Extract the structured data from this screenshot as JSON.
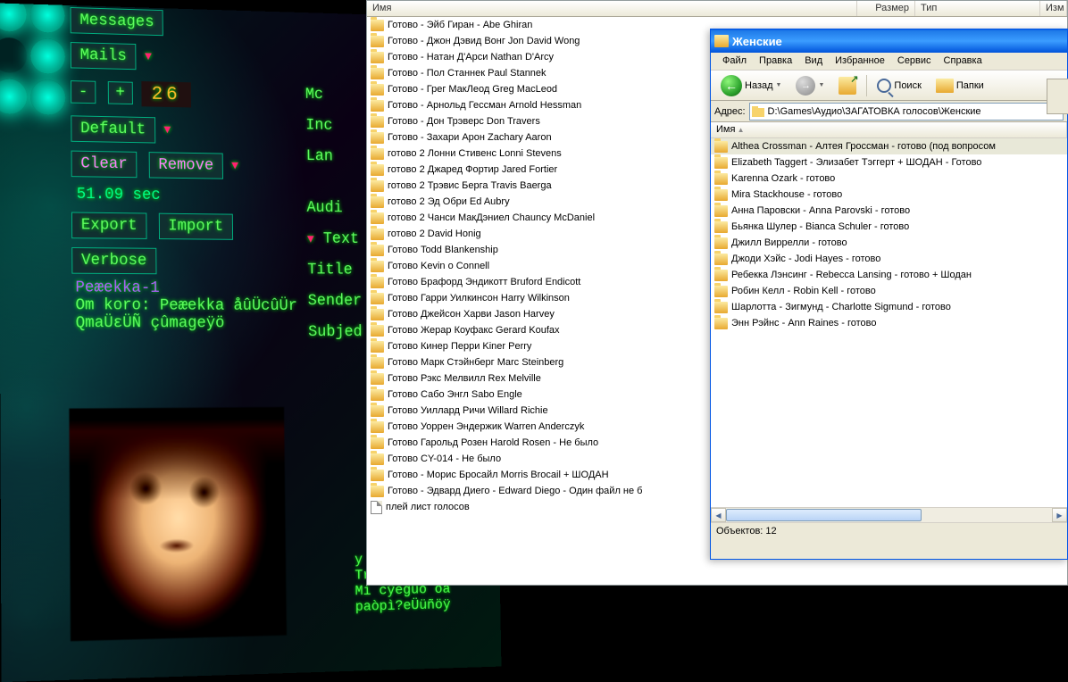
{
  "game": {
    "messages": "Messages",
    "mails": "Mails",
    "number": "26",
    "default": "Default",
    "clear": "Clear",
    "remove": "Remove",
    "timer": "51.09 sec",
    "export": "Export",
    "import": "Import",
    "verbose": "Verbose",
    "rebekka": "Peæekka-1",
    "from": "Om koro: Peæekka åûÜcûÜr",
    "line2": "QmaÜεÜÑ çûmageÿö",
    "rcol": {
      "mc": "Mc",
      "inc": "Inc",
      "lan": "Lan",
      "audi": "Audi",
      "text": "Text",
      "title": "Title",
      "sender": "Sender",
      "subj": "Subjed"
    },
    "chat": "y Æ\nTriOptimum.\nMí cÿegüö òa\npaòpì?eÜüñöÿ"
  },
  "explorer_bg": {
    "columns": {
      "name": "Имя",
      "size": "Размер",
      "type": "Тип",
      "chg": "Изм"
    },
    "items": [
      {
        "t": "folder",
        "n": "Готово - Эйб Гиран - Abe Ghiran"
      },
      {
        "t": "folder",
        "n": "Готово - Джон Дэвид Вонг  Jon David Wong"
      },
      {
        "t": "folder",
        "n": "Готово - Натан Д'Арси Nathan D'Arcy"
      },
      {
        "t": "folder",
        "n": "Готово - Пол Станнек Paul Stannek"
      },
      {
        "t": "folder",
        "n": "Готово - Грег МакЛеод Greg MacLeod"
      },
      {
        "t": "folder",
        "n": "Готово - Арнольд Гессман Arnold Hessman"
      },
      {
        "t": "folder",
        "n": "Готово - Дон Трэверс Don Travers"
      },
      {
        "t": "folder",
        "n": "Готово - Захари Арон  Zachary Aaron"
      },
      {
        "t": "folder",
        "n": "готово 2 Лонни Стивенс  Lonni Stevens"
      },
      {
        "t": "folder",
        "n": "готово 2 Джаред Фортир Jared Fortier"
      },
      {
        "t": "folder",
        "n": "готово 2 Трэвис Берга Travis Baerga"
      },
      {
        "t": "folder",
        "n": "готово 2 Эд Обри  Ed Aubry"
      },
      {
        "t": "folder",
        "n": "готово 2 Чанси МакДэниел Chauncy McDaniel"
      },
      {
        "t": "folder",
        "n": "готово 2 David Honig"
      },
      {
        "t": "folder",
        "n": "Готово Todd Blankenship"
      },
      {
        "t": "folder",
        "n": "Готово Kevin o Connell"
      },
      {
        "t": "folder",
        "n": "Готово Брафорд Эндикотт Bruford Endicott"
      },
      {
        "t": "folder",
        "n": "Готово Гарри Уилкинсон Harry Wilkinson"
      },
      {
        "t": "folder",
        "n": "Готово Джейсон Харви Jason Harvey"
      },
      {
        "t": "folder",
        "n": "Готово Жерар Коуфакс Gerard Koufax"
      },
      {
        "t": "folder",
        "n": "Готово Кинер Перри Kiner Perry"
      },
      {
        "t": "folder",
        "n": "Готово Марк Стэйнберг Marc Steinberg"
      },
      {
        "t": "folder",
        "n": "Готово Рэкс Мелвилл Rex Melville"
      },
      {
        "t": "folder",
        "n": "Готово Сабо Энгл Sabo Engle"
      },
      {
        "t": "folder",
        "n": "Готово Уиллард Ричи Willard Richie"
      },
      {
        "t": "folder",
        "n": "Готово Уоррен Эндержик Warren Anderczyk"
      },
      {
        "t": "folder",
        "n": "Готово Гарольд Розен Harold Rosen - Не было"
      },
      {
        "t": "folder",
        "n": "Готово CY-014 - Не было"
      },
      {
        "t": "folder",
        "n": "Готово - Морис Бросайл Morris Brocail + ШОДАН"
      },
      {
        "t": "folder",
        "n": "Готово - Эдвард Диего - Edward Diego - Один файл не б"
      },
      {
        "t": "file",
        "n": "плей лист голосов"
      }
    ]
  },
  "explorer_fg": {
    "title": "Женские",
    "menus": [
      "Файл",
      "Правка",
      "Вид",
      "Избранное",
      "Сервис",
      "Справка"
    ],
    "toolbar": {
      "back": "Назад",
      "search": "Поиск",
      "folders": "Папки"
    },
    "address_label": "Адрес:",
    "address": "D:\\Games\\Аудио\\ЗАГАТОВКА голосов\\Женские",
    "columns": {
      "name": "Имя"
    },
    "items": [
      {
        "n": "Althea Crossman - Алтея Гроссман - готово (под вопросом",
        "sel": true
      },
      {
        "n": "Elizabeth Taggert - Элизабет Тэггерт + ШОДАН - Готово"
      },
      {
        "n": "Karenna Ozark - готово"
      },
      {
        "n": "Mira Stackhouse - готово"
      },
      {
        "n": "Анна Паровски - Anna Parovski - готово"
      },
      {
        "n": "Бьянка Шулер - Bianca Schuler - готово"
      },
      {
        "n": "Джилл Виррелли - готово"
      },
      {
        "n": "Джоди Хэйс - Jodi Hayes - готово"
      },
      {
        "n": "Ребекка Лэнсинг - Rebecca Lansing - готово + Шодан"
      },
      {
        "n": "Робин Келл - Robin Kell - готово"
      },
      {
        "n": "Шарлотта - Зигмунд - Charlotte Sigmund - готово"
      },
      {
        "n": "Энн Рэйнс - Ann Raines - готово"
      }
    ],
    "status": "Объектов: 12"
  }
}
